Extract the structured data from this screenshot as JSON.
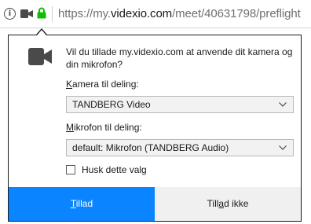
{
  "url_bar": {
    "info_icon": "info-icon",
    "camera_icon": "camera-icon",
    "lock_icon": "lock-icon",
    "url_prefix": "https://my.",
    "url_domain": "videxio.com",
    "url_path": "/meet/40631798/preflight",
    "lock_color": "#12bc00"
  },
  "panel": {
    "icon": "video-camera-icon",
    "prompt": "Vil du tillade my.videxio.com at anvende dit kamera og din mikrofon?",
    "camera_label_accesskey": "K",
    "camera_label_rest": "amera til deling:",
    "camera_selected": "TANDBERG Video",
    "mic_label_accesskey": "M",
    "mic_label_rest": "ikrofon til deling:",
    "mic_selected": "default: Mikrofon (TANDBERG Audio)",
    "remember_label": "Husk dette valg",
    "remember_checked": false,
    "allow_accesskey": "T",
    "allow_rest": "illad",
    "deny_prefix": "Till",
    "deny_accesskey": "a",
    "deny_rest": "d ikke",
    "accent_color": "#0a84ff"
  }
}
